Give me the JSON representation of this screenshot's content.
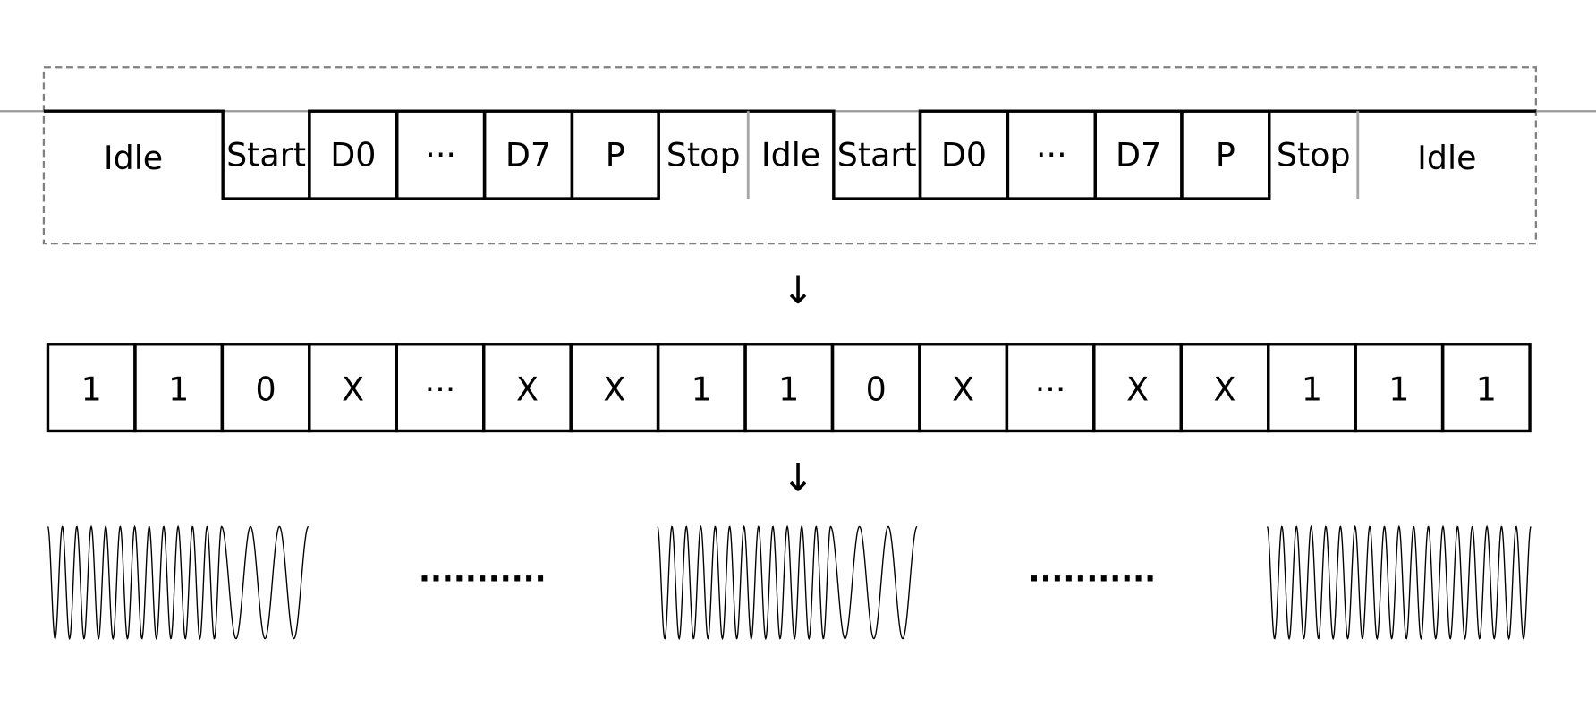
{
  "frame_signal": {
    "segments": [
      {
        "label": "Idle",
        "level": "high",
        "kind": "open"
      },
      {
        "label": "Start",
        "level": "low",
        "kind": "open"
      },
      {
        "label": "D0",
        "level": "box",
        "kind": "box"
      },
      {
        "label": "···",
        "level": "box",
        "kind": "box"
      },
      {
        "label": "D7",
        "level": "box",
        "kind": "box"
      },
      {
        "label": "P",
        "level": "box",
        "kind": "box"
      },
      {
        "label": "Stop",
        "level": "high",
        "kind": "open"
      },
      {
        "label": "Idle",
        "level": "high",
        "kind": "open"
      },
      {
        "label": "Start",
        "level": "low",
        "kind": "open"
      },
      {
        "label": "D0",
        "level": "box",
        "kind": "box"
      },
      {
        "label": "···",
        "level": "box",
        "kind": "box"
      },
      {
        "label": "D7",
        "level": "box",
        "kind": "box"
      },
      {
        "label": "P",
        "level": "box",
        "kind": "box"
      },
      {
        "label": "Stop",
        "level": "high",
        "kind": "open"
      },
      {
        "label": "Idle",
        "level": "high",
        "kind": "open"
      }
    ]
  },
  "arrows": [
    "↓",
    "↓"
  ],
  "bits": [
    "1",
    "1",
    "0",
    "X",
    "···",
    "X",
    "X",
    "1",
    "1",
    "0",
    "X",
    "···",
    "X",
    "X",
    "1",
    "1",
    "1"
  ],
  "waveforms": {
    "groups": [
      {
        "bits": [
          "1",
          "1",
          "0"
        ]
      },
      {
        "bits": [
          "1",
          "1",
          "0"
        ]
      },
      {
        "bits": [
          "1",
          "1",
          "1"
        ]
      }
    ],
    "gap_label": "···········",
    "cycles_per_bit": {
      "1": 6,
      "0": 3
    }
  },
  "colors": {
    "line": "#000000",
    "dashed_box": "#808080",
    "divider": "#a6a6a6"
  }
}
